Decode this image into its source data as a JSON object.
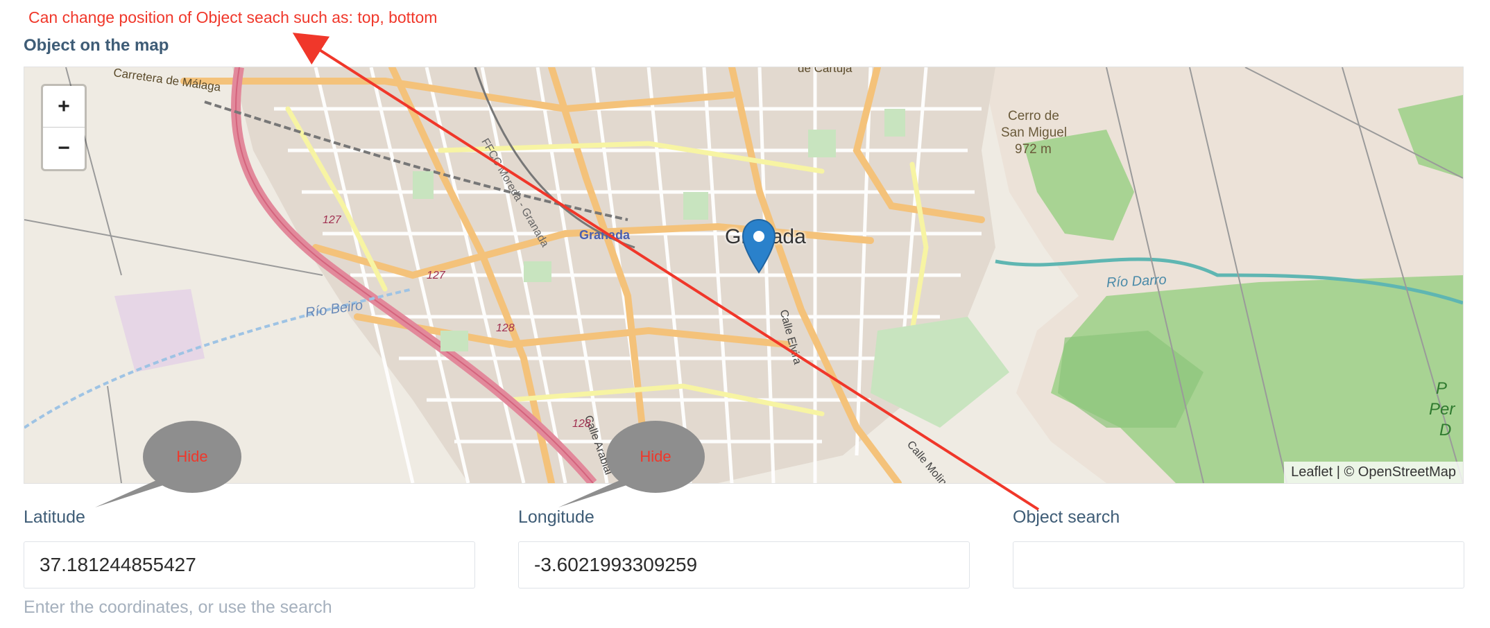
{
  "annotation": {
    "note": "Can change position of Object seach such as: top, bottom",
    "hide_label": "Hide",
    "color": "#f0372a"
  },
  "section": {
    "title": "Object on the map"
  },
  "map": {
    "zoom_in": "+",
    "zoom_out": "−",
    "attribution_leaflet": "Leaflet",
    "attribution_sep": " | © ",
    "attribution_osm": "OpenStreetMap",
    "city": "Granada",
    "labels": {
      "road_malaga": "Carretera de Málaga",
      "station": "Granada",
      "cerro": "Cerro de",
      "san_miguel": "San Miguel",
      "elev": "972 m",
      "rio_beiro": "Río Beiro",
      "rio_darro": "Río Darro",
      "calle_elvira": "Calle Elvira",
      "calle_arabial": "Calle Arabial",
      "calle_molinos": "Calle Molinos",
      "cartuja": "de Cartuja",
      "r127a": "127",
      "r127b": "127",
      "r128a": "128",
      "r128b": "128",
      "rail": "FFCC Moreda - Granada",
      "edge1": "P",
      "edge2": "Per",
      "edge3": "D"
    },
    "marker_icon": "map-pin-icon"
  },
  "fields": {
    "latitude": {
      "label": "Latitude",
      "value": "37.181244855427"
    },
    "longitude": {
      "label": "Longitude",
      "value": "-3.6021993309259"
    },
    "search": {
      "label": "Object search",
      "value": "",
      "placeholder": ""
    }
  },
  "help_text": "Enter the coordinates, or use the search",
  "colors": {
    "label": "#3e5c76",
    "hint": "#a5b0bd",
    "map_bg": "#efebe3",
    "road_orange": "#f4c27a",
    "road_yellow": "#f7f4a3",
    "motorway": "#e2899b",
    "park": "#c8e4bf",
    "forest": "#a8d393",
    "river": "#8ed1c6",
    "marker": "#2a81cb"
  }
}
